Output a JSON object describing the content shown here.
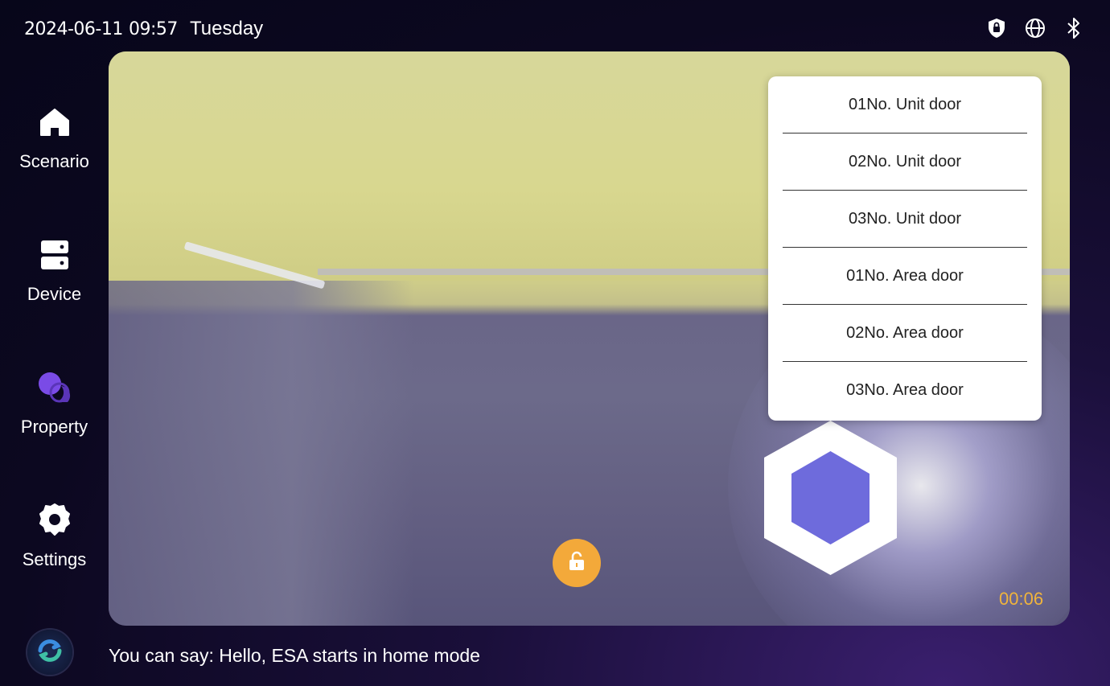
{
  "status_bar": {
    "date": "2024-06-11",
    "time": "09:57",
    "weekday": "Tuesday",
    "icons": [
      "security-shield-icon",
      "globe-icon",
      "bluetooth-icon"
    ]
  },
  "sidebar": {
    "items": [
      {
        "label": "Scenario",
        "icon": "home-icon"
      },
      {
        "label": "Device",
        "icon": "device-icon"
      },
      {
        "label": "Property",
        "icon": "chat-bubbles-icon",
        "icon_color": "#7a4be6"
      },
      {
        "label": "Settings",
        "icon": "gear-icon"
      }
    ]
  },
  "door_menu": {
    "items": [
      "01No. Unit door",
      "02No. Unit door",
      "03No. Unit door",
      "01No. Area door",
      "02No. Area door",
      "03No. Area door"
    ]
  },
  "video": {
    "timer": "00:06",
    "timer_color": "#f0b43c",
    "unlock_color": "#f3a93a"
  },
  "assistant": {
    "hint": "You can say: Hello, ESA starts in home mode"
  }
}
